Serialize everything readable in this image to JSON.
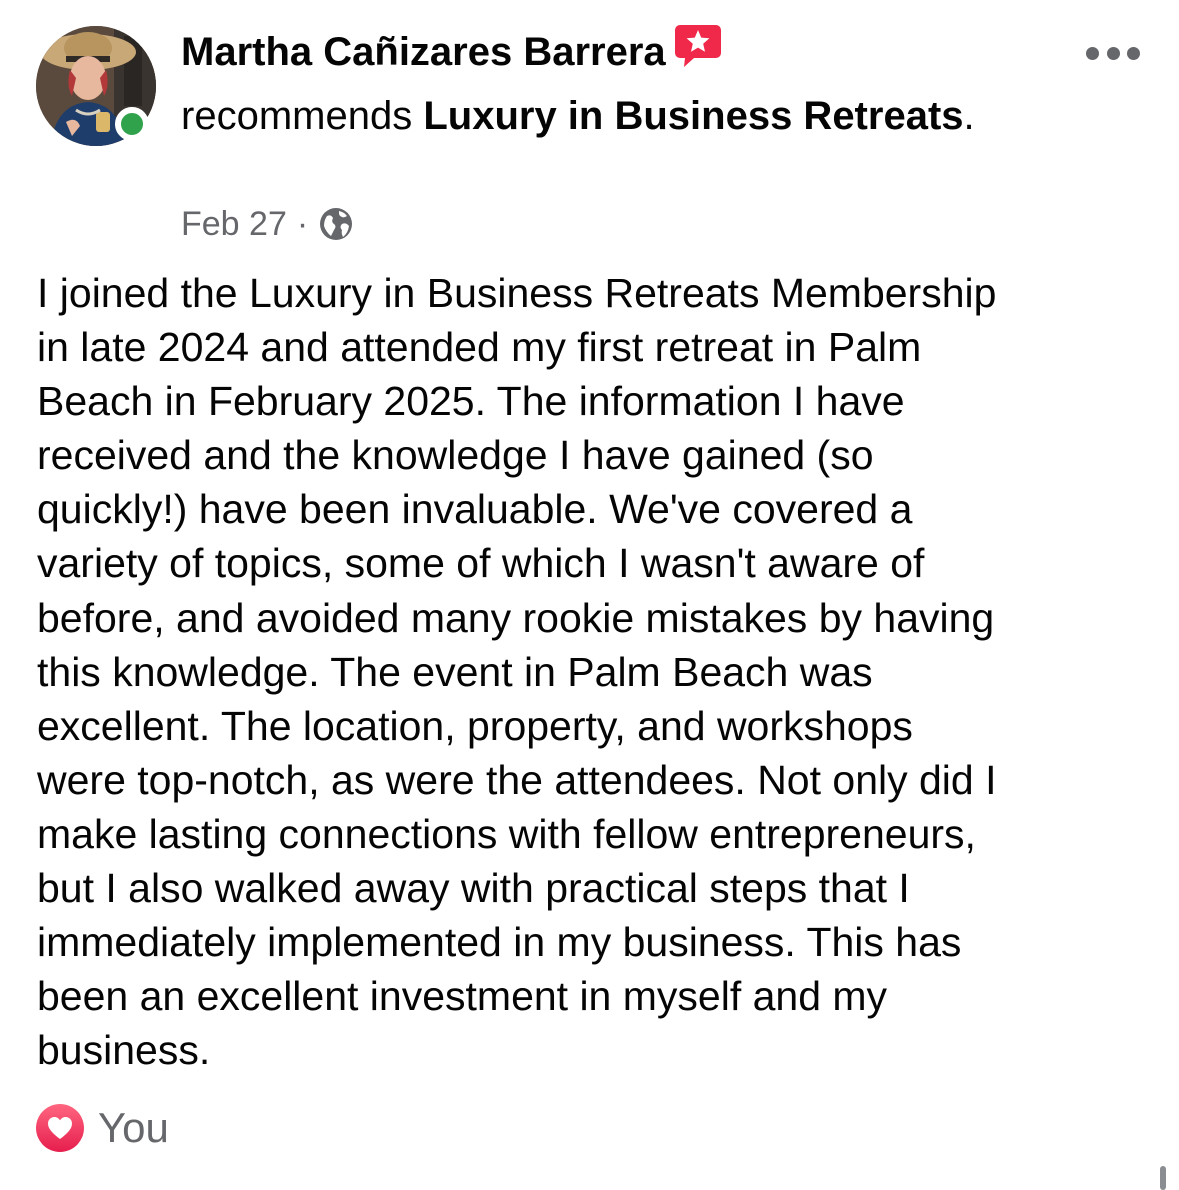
{
  "post": {
    "author": "Martha Cañizares Barrera",
    "verb": "recommends",
    "page_name": "Luxury in Business Retreats",
    "page_suffix": ".",
    "date": "Feb 27",
    "separator": "·",
    "privacy_icon": "globe-icon",
    "badge_icon": "star-speech-bubble-icon",
    "more_icon": "more-horizontal-icon",
    "body": "I joined the Luxury in Business Retreats Membership\nin late 2024 and attended my first retreat in Palm\nBeach in February 2025.  The information I have\nreceived and the knowledge I have gained (so\nquickly!) have been invaluable. We've covered a\nvariety of topics, some of which I wasn't aware of\nbefore, and avoided many rookie mistakes by having\nthis knowledge.  The event in Palm Beach was\nexcellent.  The location, property, and workshops\nwere top-notch, as were the attendees.  Not only did I\nmake lasting connections with fellow entrepreneurs,\nbut I also walked away with practical steps that I\nimmediately implemented in my business. This has\nbeen an excellent investment in myself and my\nbusiness."
  },
  "reactions": {
    "icon": "love-heart-icon",
    "label": "You"
  },
  "colors": {
    "text": "#050505",
    "secondary": "#65676b",
    "online": "#31a24c",
    "badge": "#f02849",
    "love": "#f33e58"
  }
}
